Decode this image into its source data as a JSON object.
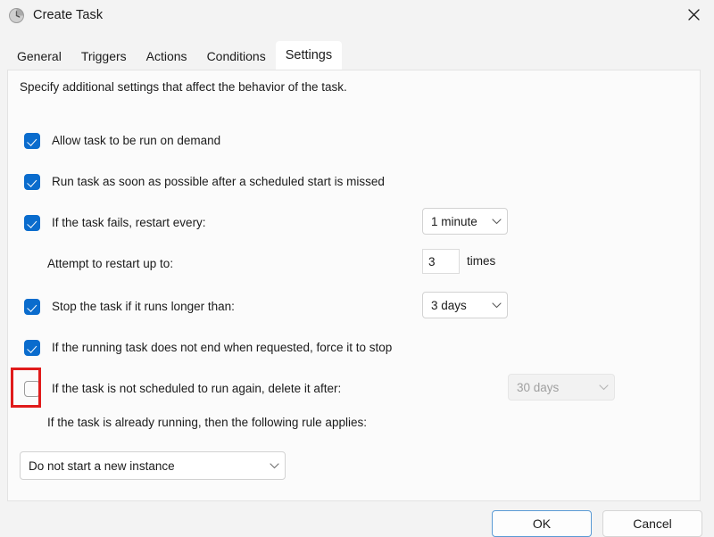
{
  "window": {
    "title": "Create Task",
    "icon": "clock-icon",
    "close_label": "✕"
  },
  "tabs": [
    {
      "label": "General",
      "active": false
    },
    {
      "label": "Triggers",
      "active": false
    },
    {
      "label": "Actions",
      "active": false
    },
    {
      "label": "Conditions",
      "active": false
    },
    {
      "label": "Settings",
      "active": true
    }
  ],
  "panel": {
    "intro": "Specify additional settings that affect the behavior of the task.",
    "rows": [
      {
        "id": "allow-on-demand",
        "checkbox": true,
        "checked": true,
        "label": "Allow task to be run on demand"
      },
      {
        "id": "run-asap-after-missed",
        "checkbox": true,
        "checked": true,
        "label": "Run task as soon as possible after a scheduled start is missed"
      },
      {
        "id": "restart-on-failure",
        "checkbox": true,
        "checked": true,
        "label": "If the task fails, restart every:"
      },
      {
        "id": "restart-attempts",
        "checkbox": false,
        "checked": false,
        "label": "Attempt to restart up to:"
      },
      {
        "id": "stop-if-runs-longer",
        "checkbox": true,
        "checked": true,
        "label": "Stop the task if it runs longer than:"
      },
      {
        "id": "force-stop",
        "checkbox": true,
        "checked": true,
        "label": "If the running task does not end when requested, force it to stop"
      },
      {
        "id": "delete-if-not-scheduled",
        "checkbox": true,
        "checked": false,
        "label": "If the task is not scheduled to run again, delete it after:",
        "highlighted": true
      }
    ],
    "restart_interval": {
      "value": "1 minute",
      "disabled": false
    },
    "restart_attempts": {
      "value": "3",
      "unit": "times"
    },
    "stop_after": {
      "value": "3 days",
      "disabled": false
    },
    "delete_after": {
      "value": "30 days",
      "disabled": true
    },
    "rule_label": "If the task is already running, then the following rule applies:",
    "instance_rule": {
      "value": "Do not start a new instance",
      "disabled": false
    }
  },
  "footer": {
    "ok_label": "OK",
    "cancel_label": "Cancel"
  },
  "colors": {
    "accent": "#0a6ccd",
    "highlight": "#e01b1b",
    "default_button_border": "#5b9bd5"
  }
}
